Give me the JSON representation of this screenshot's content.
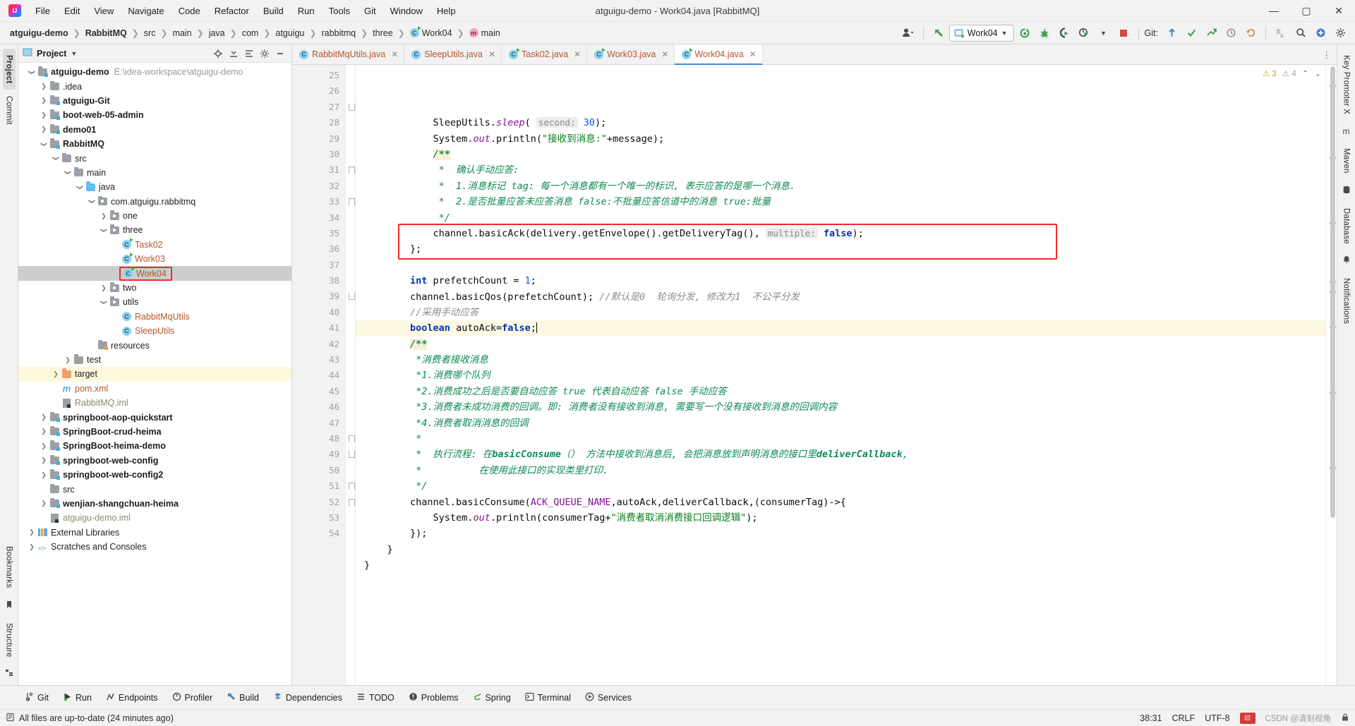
{
  "window": {
    "title": "atguigu-demo - Work04.java [RabbitMQ]",
    "minimize": "—",
    "maximize": "▢",
    "close": "✕"
  },
  "menu": [
    "File",
    "Edit",
    "View",
    "Navigate",
    "Code",
    "Refactor",
    "Build",
    "Run",
    "Tools",
    "Git",
    "Window",
    "Help"
  ],
  "breadcrumb": [
    {
      "label": "atguigu-demo",
      "bold": true,
      "icon": ""
    },
    {
      "label": "RabbitMQ",
      "bold": true,
      "icon": ""
    },
    {
      "label": "src",
      "bold": false,
      "icon": ""
    },
    {
      "label": "main",
      "bold": false,
      "icon": ""
    },
    {
      "label": "java",
      "bold": false,
      "icon": ""
    },
    {
      "label": "com",
      "bold": false,
      "icon": ""
    },
    {
      "label": "atguigu",
      "bold": false,
      "icon": ""
    },
    {
      "label": "rabbitmq",
      "bold": false,
      "icon": ""
    },
    {
      "label": "three",
      "bold": false,
      "icon": ""
    },
    {
      "label": "Work04",
      "bold": false,
      "icon": "class-icon"
    },
    {
      "label": "main",
      "bold": false,
      "icon": "method-icon"
    }
  ],
  "toolbar": {
    "run_config": "Work04",
    "git_label": "Git:",
    "icons": [
      "user-icon",
      "back-arrow-icon",
      "run-icon",
      "debug-icon",
      "run-coverage-icon",
      "profiler-icon",
      "stop-icon"
    ],
    "git_icons": [
      "update-project-icon",
      "commit-icon",
      "push-icon",
      "history-icon",
      "rollback-icon"
    ],
    "right_icons": [
      "translate-icon",
      "search-icon",
      "plugins-icon",
      "settings-icon"
    ]
  },
  "project_panel": {
    "title": "Project",
    "header_actions": [
      "locate-icon",
      "collapse-all-icon",
      "expand-icon",
      "settings-icon",
      "hide-icon"
    ],
    "tree": [
      {
        "indent": 0,
        "arrow": "down",
        "icon": "module-folder",
        "label": "atguigu-demo",
        "bold": true,
        "path": "E:\\idea-workspace\\atguigu-demo"
      },
      {
        "indent": 1,
        "arrow": "right",
        "icon": "folder",
        "label": ".idea",
        "bold": false
      },
      {
        "indent": 1,
        "arrow": "right",
        "icon": "module-folder",
        "label": "atguigu-Git",
        "bold": true
      },
      {
        "indent": 1,
        "arrow": "right",
        "icon": "module-folder",
        "label": "boot-web-05-admin",
        "bold": true
      },
      {
        "indent": 1,
        "arrow": "right",
        "icon": "module-folder",
        "label": "demo01",
        "bold": true
      },
      {
        "indent": 1,
        "arrow": "down",
        "icon": "module-folder",
        "label": "RabbitMQ",
        "bold": true
      },
      {
        "indent": 2,
        "arrow": "down",
        "icon": "folder",
        "label": "src",
        "bold": false
      },
      {
        "indent": 3,
        "arrow": "down",
        "icon": "folder",
        "label": "main",
        "bold": false
      },
      {
        "indent": 4,
        "arrow": "down",
        "icon": "source-folder",
        "label": "java",
        "bold": false
      },
      {
        "indent": 5,
        "arrow": "down",
        "icon": "package",
        "label": "com.atguigu.rabbitmq",
        "bold": false
      },
      {
        "indent": 6,
        "arrow": "right",
        "icon": "package",
        "label": "one",
        "bold": false
      },
      {
        "indent": 6,
        "arrow": "down",
        "icon": "package",
        "label": "three",
        "bold": false
      },
      {
        "indent": 7,
        "arrow": "none",
        "icon": "class-runnable",
        "label": "Task02",
        "bold": false,
        "kind": "cls"
      },
      {
        "indent": 7,
        "arrow": "none",
        "icon": "class-runnable",
        "label": "Work03",
        "bold": false,
        "kind": "cls"
      },
      {
        "indent": 7,
        "arrow": "none",
        "icon": "class-runnable",
        "label": "Work04",
        "bold": false,
        "kind": "cls",
        "selected": true,
        "boxed": true
      },
      {
        "indent": 6,
        "arrow": "right",
        "icon": "package",
        "label": "two",
        "bold": false
      },
      {
        "indent": 6,
        "arrow": "down",
        "icon": "package",
        "label": "utils",
        "bold": false
      },
      {
        "indent": 7,
        "arrow": "none",
        "icon": "class",
        "label": "RabbitMqUtils",
        "bold": false,
        "kind": "cls"
      },
      {
        "indent": 7,
        "arrow": "none",
        "icon": "class",
        "label": "SleepUtils",
        "bold": false,
        "kind": "cls"
      },
      {
        "indent": 5,
        "arrow": "none",
        "icon": "resource-folder",
        "label": "resources",
        "bold": false
      },
      {
        "indent": 3,
        "arrow": "right",
        "icon": "folder",
        "label": "test",
        "bold": false
      },
      {
        "indent": 2,
        "arrow": "right",
        "icon": "target-folder",
        "label": "target",
        "bold": false,
        "highlight": true
      },
      {
        "indent": 2,
        "arrow": "none",
        "icon": "maven-icon",
        "label": "pom.xml",
        "bold": false,
        "kind": "xml"
      },
      {
        "indent": 2,
        "arrow": "none",
        "icon": "iml-icon",
        "label": "RabbitMQ.iml",
        "bold": false,
        "kind": "iml"
      },
      {
        "indent": 1,
        "arrow": "right",
        "icon": "module-folder",
        "label": "springboot-aop-quickstart",
        "bold": true
      },
      {
        "indent": 1,
        "arrow": "right",
        "icon": "module-folder",
        "label": "SpringBoot-crud-heima",
        "bold": true
      },
      {
        "indent": 1,
        "arrow": "right",
        "icon": "module-folder",
        "label": "SpringBoot-heima-demo",
        "bold": true
      },
      {
        "indent": 1,
        "arrow": "right",
        "icon": "module-folder",
        "label": "springboot-web-config",
        "bold": true
      },
      {
        "indent": 1,
        "arrow": "right",
        "icon": "module-folder",
        "label": "springboot-web-config2",
        "bold": true
      },
      {
        "indent": 1,
        "arrow": "none",
        "icon": "folder",
        "label": "src",
        "bold": false
      },
      {
        "indent": 1,
        "arrow": "right",
        "icon": "module-folder",
        "label": "wenjian-shangchuan-heima",
        "bold": true
      },
      {
        "indent": 1,
        "arrow": "none",
        "icon": "iml-icon",
        "label": "atguigu-demo.iml",
        "bold": false,
        "kind": "iml"
      },
      {
        "indent": 0,
        "arrow": "right",
        "icon": "library-icon",
        "label": "External Libraries",
        "bold": false
      },
      {
        "indent": 0,
        "arrow": "right",
        "icon": "scratches-icon",
        "label": "Scratches and Consoles",
        "bold": false
      }
    ]
  },
  "left_strip": {
    "tabs": [
      "Project",
      "Commit"
    ],
    "icons": [
      "structure-icon",
      "bookmarks-icon"
    ],
    "bottom": [
      "Structure",
      "Bookmarks"
    ]
  },
  "right_strip": {
    "tabs": [
      "Key Promoter X",
      "Maven",
      "Database",
      "Notifications"
    ]
  },
  "editor_tabs": [
    {
      "label": "RabbitMqUtils.java",
      "icon": "class-icon",
      "active": false
    },
    {
      "label": "SleepUtils.java",
      "icon": "class-icon",
      "active": false
    },
    {
      "label": "Task02.java",
      "icon": "class-runnable-icon",
      "active": false
    },
    {
      "label": "Work03.java",
      "icon": "class-runnable-icon",
      "active": false
    },
    {
      "label": "Work04.java",
      "icon": "class-runnable-icon",
      "active": true
    }
  ],
  "inspection": {
    "warnings": "3",
    "weak_warnings": "4",
    "warn_icon": "warning-triangle-icon",
    "weak_icon": "weak-warning-icon"
  },
  "code": {
    "first_line": 25,
    "lines": [
      {
        "n": 25,
        "html": "            SleepUtils.<i class='stat'>sleep</i>( <span class='hint'>second:</span> <span class='num'>30</span>);"
      },
      {
        "n": 26,
        "html": "            System.<i class='stat'>out</i>.println(<span class='str'>\"接收到消息:\"</span>+message);"
      },
      {
        "n": 27,
        "html": "            <span class='docb docbg'>/**</span>",
        "fold": "dn"
      },
      {
        "n": 28,
        "html": "             <span class='doc'>*  确认手动应答:</span>"
      },
      {
        "n": 29,
        "html": "             <span class='doc'>*  1.消息标记 <i>tag</i>: 每一个消息都有一个唯一的标识, 表示应答的是哪一个消息.</span>"
      },
      {
        "n": 30,
        "html": "             <span class='doc'>*  2.是否批量应答未应答消息 <i>false</i>:不批量应答信道中的消息 <i>true</i>:批量</span>"
      },
      {
        "n": 31,
        "html": "             <span class='doc'>*/</span>",
        "fold": "up"
      },
      {
        "n": 32,
        "html": "            channel.basicAck(delivery.getEnvelope().getDeliveryTag(), <span class='hint'>multiple:</span> <span class='kw'>false</span>);"
      },
      {
        "n": 33,
        "html": "        };",
        "fold": "up"
      },
      {
        "n": 34,
        "html": ""
      },
      {
        "n": 35,
        "html": "        <span class='kw'>int</span> prefetchCount = <span class='num'>1</span>;"
      },
      {
        "n": 36,
        "html": "        channel.basicQos(prefetchCount); <span class='cmt'>//默认是0  轮询分发, 修改为1  不公平分发</span>"
      },
      {
        "n": 37,
        "html": "        <span class='cmt'>//采用手动应答</span>"
      },
      {
        "n": 38,
        "html": "        <span class='kw'>boolean</span> autoAck=<span class='kw'>false</span>;<span class='caret'></span>",
        "current": true
      },
      {
        "n": 39,
        "html": "        <span class='docb docbg'>/**</span>",
        "fold": "dn"
      },
      {
        "n": 40,
        "html": "         <span class='doc'>*消费者接收消息</span>"
      },
      {
        "n": 41,
        "html": "         <span class='doc'>*1.消费哪个队列</span>"
      },
      {
        "n": 42,
        "html": "         <span class='doc'>*2.消费成功之后是否要自动应答 <i>true</i> 代表自动应答 <i>false</i> 手动应答</span>"
      },
      {
        "n": 43,
        "html": "         <span class='doc'>*3.消费者未成功消费的回调。即: 消费者没有接收到消息, 需要写一个没有接收到消息的回调内容</span>"
      },
      {
        "n": 44,
        "html": "         <span class='doc'>*4.消费者取消消息的回调</span>"
      },
      {
        "n": 45,
        "html": "         <span class='doc'>*</span>"
      },
      {
        "n": 46,
        "html": "         <span class='doc'>*  执行流程: 在<b>basicConsume</b>（） 方法中接收到消息后, 会把消息放到声明消息的接口里<b>deliverCallback</b>,</span>"
      },
      {
        "n": 47,
        "html": "         <span class='doc'>*          在使用此接口的实现类里打印.</span>"
      },
      {
        "n": 48,
        "html": "         <span class='doc'>*/</span>",
        "fold": "up"
      },
      {
        "n": 49,
        "html": "        channel.basicConsume(<span class='cnst'>ACK_QUEUE_NAME</span>,autoAck,deliverCallback,(consumerTag)-&gt;{",
        "fold": "dn"
      },
      {
        "n": 50,
        "html": "            System.<i class='stat'>out</i>.println(consumerTag+<span class='str'>\"消费者取消消费接口回调逻辑\"</span>);"
      },
      {
        "n": 51,
        "html": "        });",
        "fold": "up"
      },
      {
        "n": 52,
        "html": "    }",
        "fold": "up"
      },
      {
        "n": 53,
        "html": "}"
      },
      {
        "n": 54,
        "html": ""
      }
    ]
  },
  "tool_window_bar": [
    {
      "label": "Git",
      "icon": "git-icon"
    },
    {
      "label": "Run",
      "icon": "run-icon"
    },
    {
      "label": "Endpoints",
      "icon": "endpoints-icon"
    },
    {
      "label": "Profiler",
      "icon": "profiler-icon"
    },
    {
      "label": "Build",
      "icon": "build-icon"
    },
    {
      "label": "Dependencies",
      "icon": "dependencies-icon"
    },
    {
      "label": "TODO",
      "icon": "todo-icon"
    },
    {
      "label": "Problems",
      "icon": "problems-icon"
    },
    {
      "label": "Spring",
      "icon": "spring-icon"
    },
    {
      "label": "Terminal",
      "icon": "terminal-icon"
    },
    {
      "label": "Services",
      "icon": "services-icon"
    }
  ],
  "status_bar": {
    "message": "All files are up-to-date (24 minutes ago)",
    "caret": "38:31",
    "line_sep": "CRLF",
    "encoding": "UTF-8",
    "indent": "",
    "watermark": "CSDN @清刻视角",
    "icons": [
      "memory-icon",
      "lock-icon"
    ]
  }
}
